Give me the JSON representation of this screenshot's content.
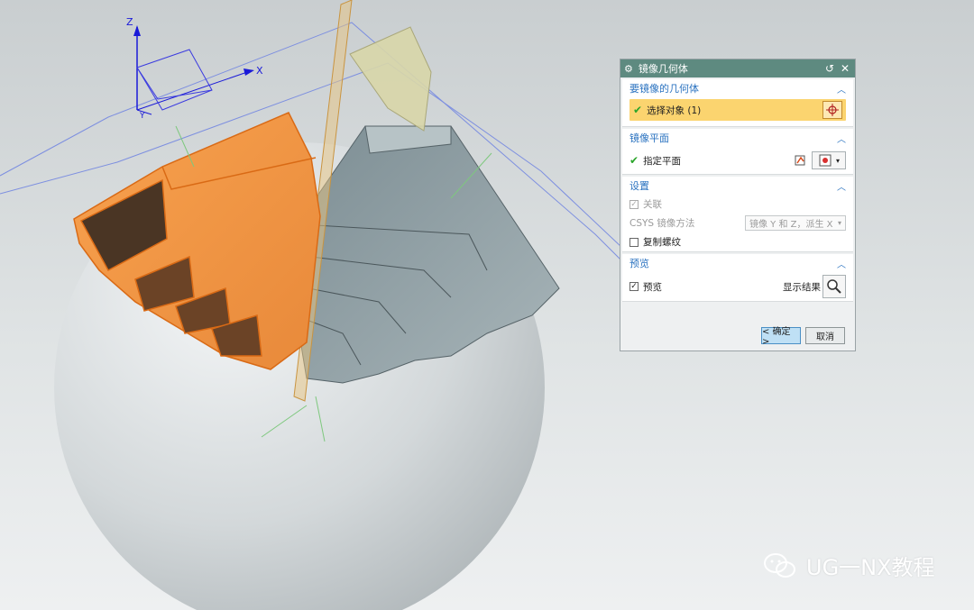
{
  "dialog": {
    "title": "镜像几何体",
    "sections": {
      "geometry": {
        "title": "要镜像的几何体",
        "select_label": "选择对象 (1)"
      },
      "plane": {
        "title": "镜像平面",
        "specify_label": "指定平面"
      },
      "settings": {
        "title": "设置",
        "associative_label": "关联",
        "csys_label": "CSYS 镜像方法",
        "csys_value": "镜像 Y 和 Z，派生 X",
        "copy_threads_label": "复制螺纹"
      },
      "preview": {
        "title": "预览",
        "preview_label": "预览",
        "show_result_label": "显示结果"
      }
    },
    "buttons": {
      "ok": "< 确定 >",
      "cancel": "取消"
    }
  },
  "axes": {
    "z": "Z",
    "x": "X",
    "y": "Y"
  },
  "watermark": {
    "text": "UG一NX教程"
  },
  "colors": {
    "titlebar": "#5e8a80",
    "accent": "#2b73c0",
    "selection": "#fbd46f",
    "orange_body": "#f59a4a",
    "grey_body": "#8e9ea3"
  }
}
